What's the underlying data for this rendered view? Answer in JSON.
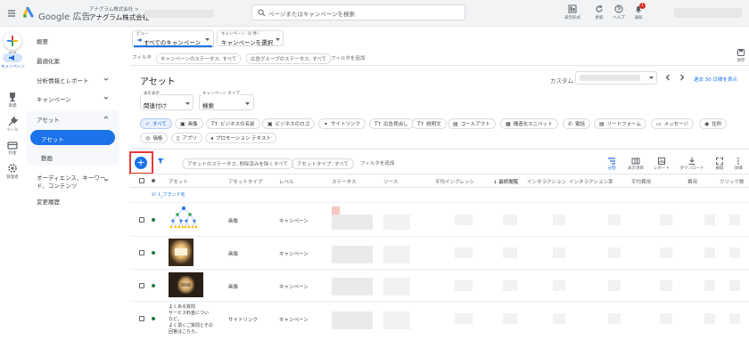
{
  "header": {
    "brand": "Google 広告",
    "account_label": "アナグラム株式会社 >",
    "account_name": "アナグラム株式会社",
    "search_placeholder": "ページまたはキャンペーンを検索",
    "actions": [
      {
        "label": "表示形式",
        "icon": "display-mode-icon"
      },
      {
        "label": "更新",
        "icon": "refresh-icon"
      },
      {
        "label": "ヘルプ",
        "icon": "help-icon"
      },
      {
        "label": "通知",
        "icon": "bell-icon",
        "badge": "1"
      }
    ]
  },
  "rail": {
    "items": [
      {
        "label": "作成",
        "icon": "plus-icon"
      },
      {
        "label": "キャンペーン",
        "icon": "campaign-icon",
        "active": true
      },
      {
        "label": "目標",
        "icon": "trophy-icon"
      },
      {
        "label": "ツール",
        "icon": "tools-icon"
      },
      {
        "label": "料金",
        "icon": "billing-icon"
      },
      {
        "label": "管理者",
        "icon": "admin-icon"
      }
    ]
  },
  "sidebar": {
    "items": [
      {
        "label": "概要"
      },
      {
        "label": "最適化案"
      },
      {
        "label": "分析情報とレポート",
        "expandable": true
      },
      {
        "label": "キャンペーン",
        "expandable": true
      },
      {
        "label": "アセット",
        "expanded": true
      },
      {
        "label": "アセット",
        "active": true
      },
      {
        "label": "動画"
      },
      {
        "label": "オーディエンス、キーワード、コンテンツ",
        "line1": "オーディエンス、キーワー",
        "line2": "ド、コンテンツ",
        "expandable": true
      },
      {
        "label": "変更履歴"
      }
    ]
  },
  "view": {
    "view_label": "ビュー",
    "view_value": "すべてのキャンペーン",
    "campaign_label": "キャンペーン（0 件）",
    "campaign_value": "キャンペーンを選択"
  },
  "filters": {
    "label": "フィルタ",
    "chips": [
      "キャンペーンのステータス: すべて",
      "広告グループのステータス: すべて"
    ],
    "add": "フィルタを追加"
  },
  "page": {
    "title": "アセット",
    "custom_label": "カスタム",
    "date_range": "過去 30 日間を表示",
    "save_label": "保存"
  },
  "selectors": {
    "display_label": "表を表示",
    "display_value": "関連付け",
    "type_label": "キャンペーン タイプ",
    "type_value": "検索"
  },
  "chips": [
    {
      "label": "すべて",
      "icon": "✓",
      "selected": true
    },
    {
      "label": "画像",
      "icon": "▣"
    },
    {
      "label": "ビジネスの名前",
      "icon": "Tт"
    },
    {
      "label": "ビジネスのロゴ",
      "icon": "▣"
    },
    {
      "label": "サイトリンク",
      "icon": "⚭"
    },
    {
      "label": "広告見出し",
      "icon": "Tт"
    },
    {
      "label": "説明文",
      "icon": "Tт"
    },
    {
      "label": "コールアウト",
      "icon": "▤"
    },
    {
      "label": "構造化スニペット",
      "icon": "▦"
    },
    {
      "label": "電話",
      "icon": "✆"
    },
    {
      "label": "リードフォーム",
      "icon": "▤"
    },
    {
      "label": "メッセージ",
      "icon": "▭"
    },
    {
      "label": "住所",
      "icon": "◉"
    },
    {
      "label": "価格",
      "icon": "◎"
    },
    {
      "label": "アプリ",
      "icon": "▯"
    },
    {
      "label": "プロモーション テキスト",
      "icon": "◂"
    }
  ],
  "toolbar": {
    "fab": "+",
    "filter_chips": [
      "アセットのステータス: 削除済みを除くすべて",
      "アセットタイプ: すべて"
    ],
    "add_filter": "フィルタを追加",
    "actions": [
      {
        "label": "分割",
        "icon": "segment-icon"
      },
      {
        "label": "表示項目",
        "icon": "columns-icon"
      },
      {
        "label": "レポート",
        "icon": "report-icon"
      },
      {
        "label": "ダウンロード",
        "icon": "download-icon"
      },
      {
        "label": "展開",
        "icon": "expand-icon"
      },
      {
        "label": "詳細",
        "icon": "more-icon"
      }
    ]
  },
  "table": {
    "columns": [
      "アセット",
      "アセットタイプ",
      "レベル",
      "ステータス",
      "ソース",
      "平均インプレッシ",
      "↓ 最終閲覧",
      "インタラクション",
      "インタラクション率",
      "平均費用",
      "費用",
      "クリック数"
    ],
    "group_label": "ﾓﾄﾞﾙ_ブランド名",
    "rows": [
      {
        "asset": "",
        "type": "画像",
        "level": "キャンペーン",
        "thumb": "tree"
      },
      {
        "asset": "",
        "type": "画像",
        "level": "キャンペーン",
        "thumb": "lamp"
      },
      {
        "asset": "",
        "type": "画像",
        "level": "キャンペーン",
        "thumb": "box"
      },
      {
        "asset_lines": [
          "よくある質問",
          "サービス料金につい",
          "など。",
          "よく頂くご質問とその",
          "回答はこちら。"
        ],
        "type": "サイトリンク",
        "level": "キャンペーン",
        "thumb": "text"
      }
    ]
  }
}
